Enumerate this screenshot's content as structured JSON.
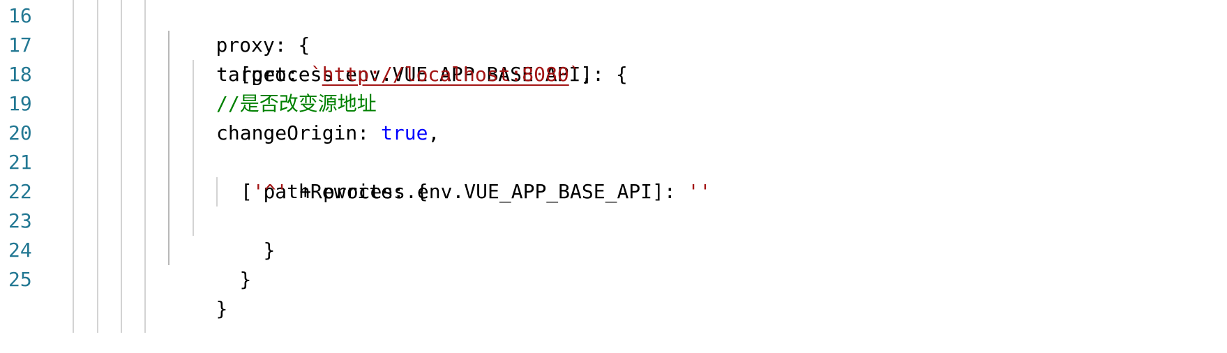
{
  "editor": {
    "line_numbers": [
      "16",
      "17",
      "18",
      "19",
      "20",
      "21",
      "22",
      "23",
      "24",
      "25"
    ],
    "lines": {
      "l16": {
        "text": "proxy: {"
      },
      "l17": {
        "text": "[process.env.VUE_APP_BASE_API]: {"
      },
      "l18": {
        "key": "target: ",
        "tick_open": "`",
        "url": "http://localhost:8080",
        "tick_close": "`",
        "tail": ","
      },
      "l19": {
        "comment": "//是否改变源地址"
      },
      "l20": {
        "key": "changeOrigin: ",
        "value": "true",
        "tail": ","
      },
      "l21": {
        "text": "pathRewrite: {"
      },
      "l22": {
        "open": "[",
        "str1": "'^'",
        "mid": " + process.env.VUE_APP_BASE_API]: ",
        "str2": "''"
      },
      "l23": {
        "text": "}"
      },
      "l24": {
        "text": "}"
      },
      "l25": {
        "text": "}"
      }
    },
    "colors": {
      "line_number": "#237893",
      "keyword": "#0000ff",
      "string": "#a31515",
      "comment": "#008000",
      "text": "#000000",
      "indent_guide": "#d3d3d3"
    }
  }
}
